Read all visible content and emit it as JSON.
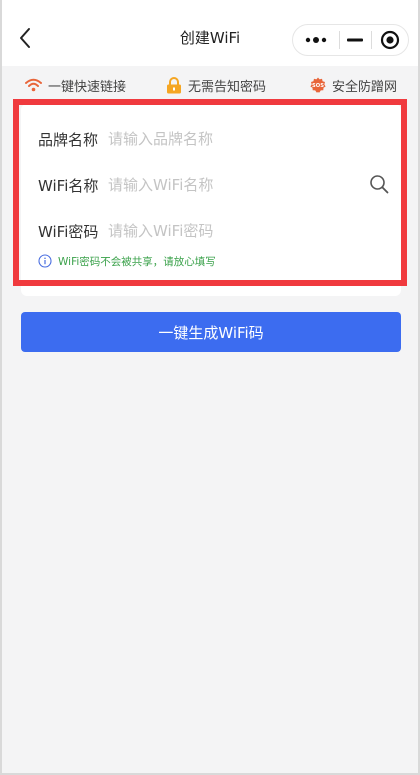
{
  "navbar": {
    "title": "创建WiFi"
  },
  "features": [
    {
      "label": "一键快速链接",
      "icon": "wifi-icon",
      "color": "#e8653a"
    },
    {
      "label": "无需告知密码",
      "icon": "lock-icon",
      "color": "#f5a623"
    },
    {
      "label": "安全防蹭网",
      "icon": "security-badge-icon",
      "badge_text": "SOS",
      "color": "#e8653a"
    }
  ],
  "form": {
    "brand": {
      "label": "品牌名称",
      "placeholder": "请输入品牌名称",
      "value": ""
    },
    "ssid": {
      "label": "WiFi名称",
      "placeholder": "请输入WiFi名称",
      "value": ""
    },
    "password": {
      "label": "WiFi密码",
      "placeholder": "请输入WiFi密码",
      "value": ""
    },
    "hint": "WiFi密码不会被共享，请放心填写"
  },
  "submit": {
    "label": "一键生成WiFi码"
  },
  "colors": {
    "primary": "#3c6cf0",
    "highlight": "#f03a3e",
    "hint": "#3aa14a"
  }
}
